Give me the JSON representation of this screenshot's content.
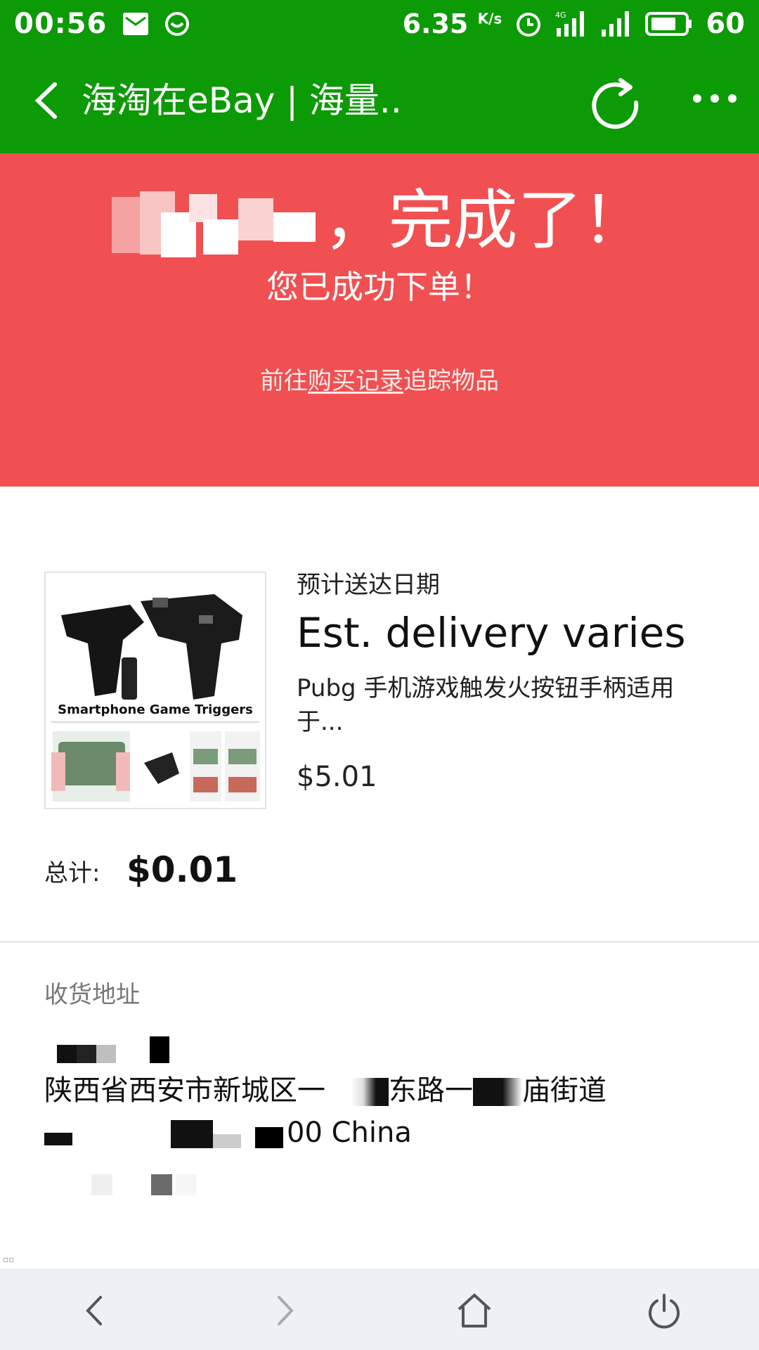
{
  "status_bar": {
    "time": "00:56",
    "speed": "6.35",
    "speed_unit": "K/s",
    "network": "4G",
    "battery": "60",
    "icons": [
      "mail-icon",
      "wechat-icon",
      "alarm-icon",
      "signal-4g-icon",
      "signal-icon",
      "battery-icon"
    ]
  },
  "title_bar": {
    "title": "海淘在eBay | 海量.."
  },
  "banner": {
    "heading_suffix": "，完成了！",
    "subheading": "您已成功下单！",
    "link_prefix": "前往",
    "link_text": "购买记录",
    "link_suffix": "追踪物品"
  },
  "order": {
    "thumbnail_caption": "Smartphone Game Triggers",
    "est_label": "预计送达日期",
    "est_value": "Est. delivery varies",
    "item_title": "Pubg 手机游戏触发火按钮手柄适用于...",
    "item_price": "$5.01",
    "total_label": "总计:",
    "total_value": "$0.01"
  },
  "address": {
    "label": "收货地址",
    "name_visible": "",
    "line1_parts": [
      "陕西省西安市新城区一",
      "东路一",
      "庙街道"
    ],
    "line2_visible": "00 China"
  },
  "colors": {
    "green": "#0c9a06",
    "banner_red": "#f05052",
    "nav_bg": "#edf1f4"
  },
  "nav_icons": [
    "back-icon",
    "forward-icon",
    "home-icon",
    "power-icon"
  ]
}
